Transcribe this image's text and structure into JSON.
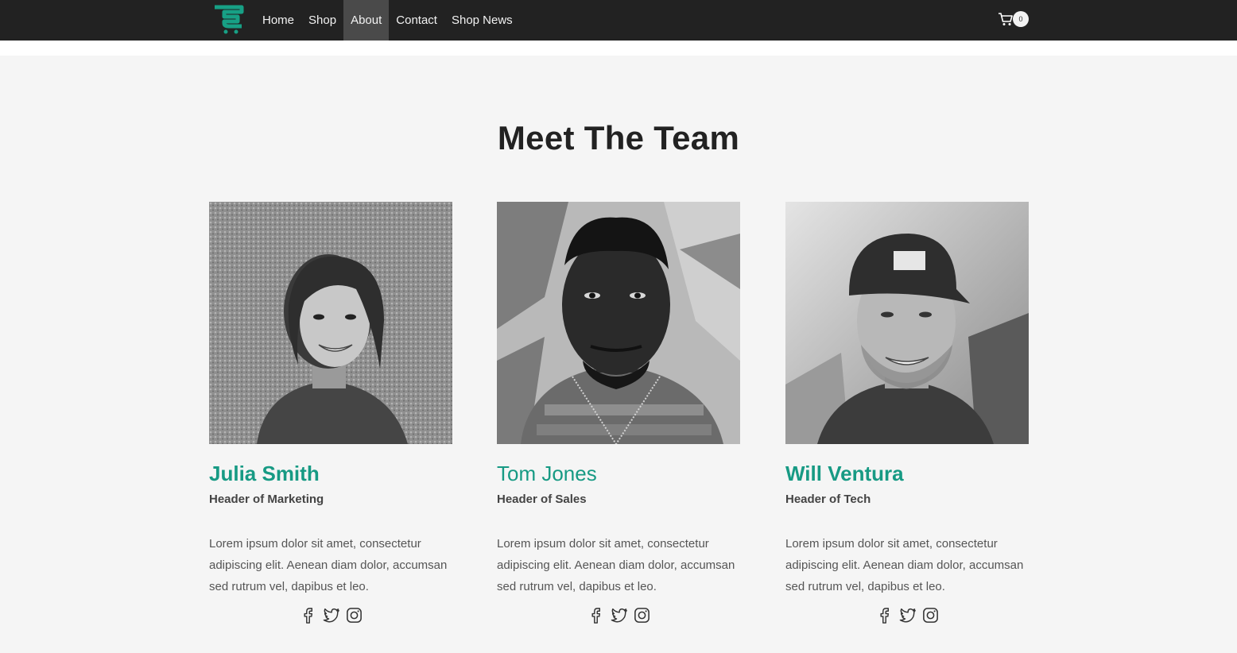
{
  "nav": {
    "items": [
      {
        "label": "Home",
        "active": false
      },
      {
        "label": "Shop",
        "active": false
      },
      {
        "label": "About",
        "active": true
      },
      {
        "label": "Contact",
        "active": false
      },
      {
        "label": "Shop News",
        "active": false
      }
    ],
    "cart_count": "0"
  },
  "colors": {
    "topbar": "#222222",
    "accent": "#179a84",
    "section_bg": "#f5f5f5"
  },
  "section": {
    "title": "Meet The Team"
  },
  "team": [
    {
      "name": "Julia Smith",
      "role": "Header of Marketing",
      "bio": "Lorem ipsum dolor sit amet, consectetur adipiscing elit. Aenean diam dolor, accumsan sed rutrum vel, dapibus et leo.",
      "photo": "woman-portrait-bw"
    },
    {
      "name": "Tom Jones",
      "role": "Header of Sales",
      "bio": "Lorem ipsum dolor sit amet, consectetur adipiscing elit. Aenean diam dolor, accumsan sed rutrum vel, dapibus et leo.",
      "photo": "man-portrait-bw"
    },
    {
      "name": "Will Ventura",
      "role": "Header of Tech",
      "bio": "Lorem ipsum dolor sit amet, consectetur adipiscing elit. Aenean diam dolor, accumsan sed rutrum vel, dapibus et leo.",
      "photo": "man-cap-portrait-bw"
    }
  ],
  "social_icons": [
    "facebook-icon",
    "twitter-icon",
    "instagram-icon"
  ]
}
